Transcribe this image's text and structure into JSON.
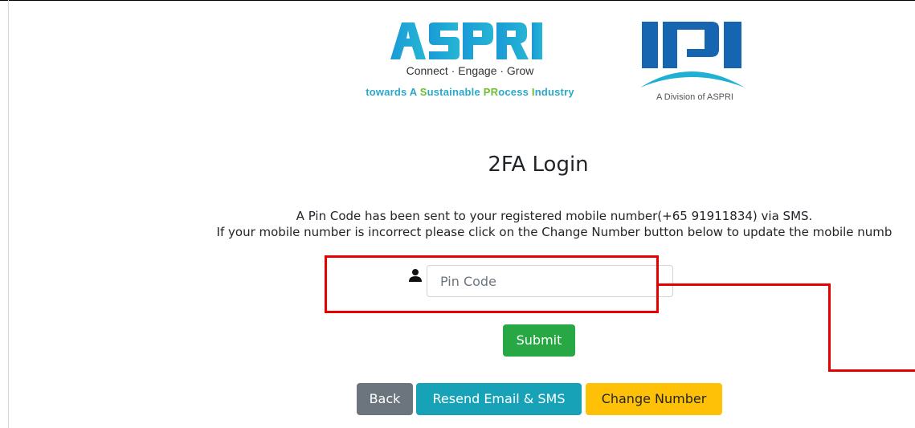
{
  "branding": {
    "aspri_logo_text": "ASPRI",
    "aspri_tagline": "Connect · Engage · Grow",
    "aspri_subline_parts": [
      {
        "text": "towards A ",
        "color": "#2aa8c9"
      },
      {
        "text": "S",
        "color": "#6cbf2e"
      },
      {
        "text": "ustainable ",
        "color": "#2aa8c9"
      },
      {
        "text": "PR",
        "color": "#6cbf2e"
      },
      {
        "text": "ocess ",
        "color": "#2aa8c9"
      },
      {
        "text": "I",
        "color": "#6cbf2e"
      },
      {
        "text": "ndustry",
        "color": "#2aa8c9"
      }
    ],
    "ipi_logo_text": "IPI",
    "ipi_caption": "A Division of ASPRI"
  },
  "page": {
    "title": "2FA Login",
    "message_line1": "A Pin Code has been sent to your registered mobile number(+65 91911834) via SMS.",
    "message_line2": "If your mobile number is incorrect please click on the Change Number button below to update the mobile numb"
  },
  "form": {
    "pin_placeholder": "Pin Code",
    "pin_value": "",
    "submit_label": "Submit"
  },
  "actions": {
    "back_label": "Back",
    "resend_label": "Resend Email & SMS",
    "change_number_label": "Change Number"
  },
  "colors": {
    "submit": "#28a745",
    "back": "#6c757d",
    "resend": "#17a2b8",
    "change_number": "#ffc107",
    "annotation": "#e60000",
    "brand_blue": "#1aa3d6",
    "brand_green": "#6cbf2e",
    "ipi_blue": "#1565b0"
  },
  "icons": {
    "pin_field": "user-icon"
  }
}
